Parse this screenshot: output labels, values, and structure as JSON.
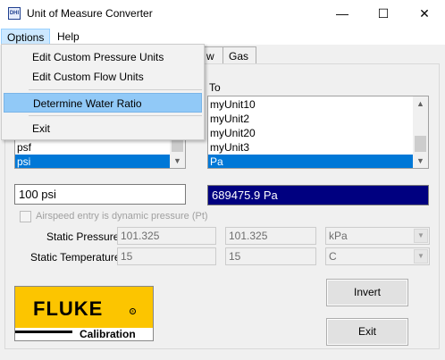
{
  "window": {
    "icon_text": "DHI",
    "title": "Unit of Measure Converter",
    "minimize_glyph": "—",
    "maximize_glyph": "☐",
    "close_glyph": "✕"
  },
  "menubar": {
    "options": "Options",
    "help": "Help"
  },
  "options_menu": [
    "Edit Custom Pressure Units",
    "Edit Custom Flow Units",
    "Determine Water Ratio",
    "Exit"
  ],
  "tabs": {
    "flow_partial": "w",
    "gas": "Gas"
  },
  "to_label": "To",
  "from_list": {
    "items": [
      "psf",
      "psi"
    ],
    "selected": "psi"
  },
  "to_list": {
    "items": [
      "myUnit10",
      "myUnit2",
      "myUnit20",
      "myUnit3",
      "Pa"
    ],
    "selected": "Pa"
  },
  "input": {
    "value": "100  psi"
  },
  "result": {
    "value": "689475.9 Pa"
  },
  "airspeed": {
    "label": "Airspeed entry  is dynamic pressure (Pt)",
    "checked": false
  },
  "static_pressure": {
    "label": "Static Pressure",
    "value1": "101.325",
    "value2": "101.325",
    "unit": "kPa"
  },
  "static_temperature": {
    "label": "Static Temperature",
    "value1": "15",
    "value2": "15",
    "unit": "C"
  },
  "buttons": {
    "invert": "Invert",
    "exit": "Exit"
  },
  "logo": {
    "brand": "FLUKE",
    "registered": "®",
    "tagline": "Calibration"
  },
  "colors": {
    "selection": "#0078d7",
    "result_bg": "#000080",
    "logo_yellow": "#fcc500",
    "menu_highlight": "#91c9f7"
  }
}
